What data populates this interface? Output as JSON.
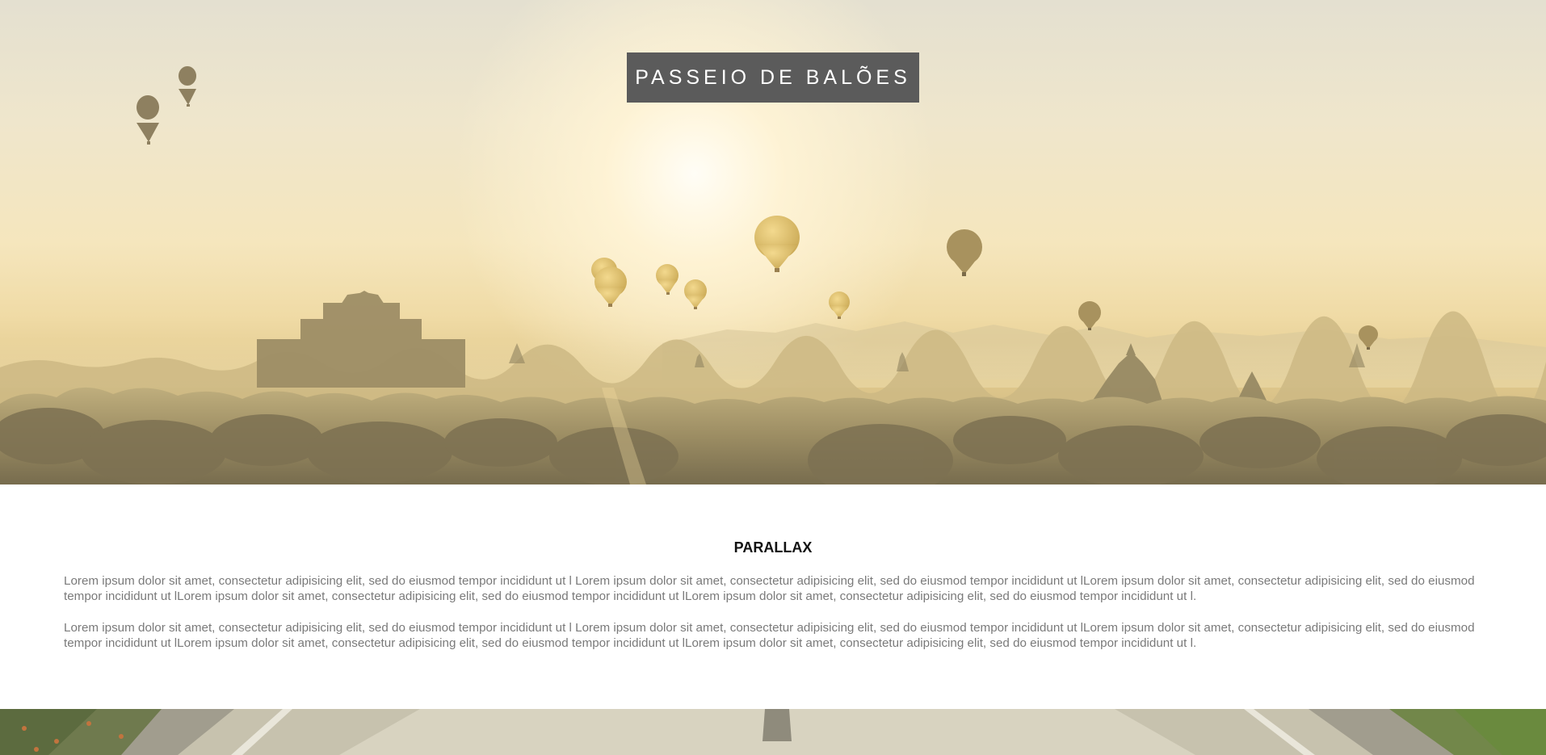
{
  "hero": {
    "title": "PASSEIO DE BALÕES",
    "image_icon": "hot-air-balloons-landscape-image"
  },
  "section": {
    "heading": "PARALLAX",
    "paragraphs": [
      "Lorem ipsum dolor sit amet, consectetur adipisicing elit, sed do eiusmod tempor incididunt ut l Lorem ipsum dolor sit amet, consectetur adipisicing elit, sed do eiusmod tempor incididunt ut lLorem ipsum dolor sit amet, consectetur adipisicing elit, sed do eiusmod tempor incididunt ut lLorem ipsum dolor sit amet, consectetur adipisicing elit, sed do eiusmod tempor incididunt ut lLorem ipsum dolor sit amet, consectetur adipisicing elit, sed do eiusmod tempor incididunt ut l.",
      "Lorem ipsum dolor sit amet, consectetur adipisicing elit, sed do eiusmod tempor incididunt ut l Lorem ipsum dolor sit amet, consectetur adipisicing elit, sed do eiusmod tempor incididunt ut lLorem ipsum dolor sit amet, consectetur adipisicing elit, sed do eiusmod tempor incididunt ut lLorem ipsum dolor sit amet, consectetur adipisicing elit, sed do eiusmod tempor incididunt ut lLorem ipsum dolor sit amet, consectetur adipisicing elit, sed do eiusmod tempor incididunt ut l."
    ]
  },
  "footer_image": {
    "image_icon": "road-landscape-image"
  },
  "colors": {
    "title_box": "#5b5b5b",
    "title_text": "#ffffff",
    "heading_text": "#111111",
    "body_text": "#7a7a7a"
  }
}
